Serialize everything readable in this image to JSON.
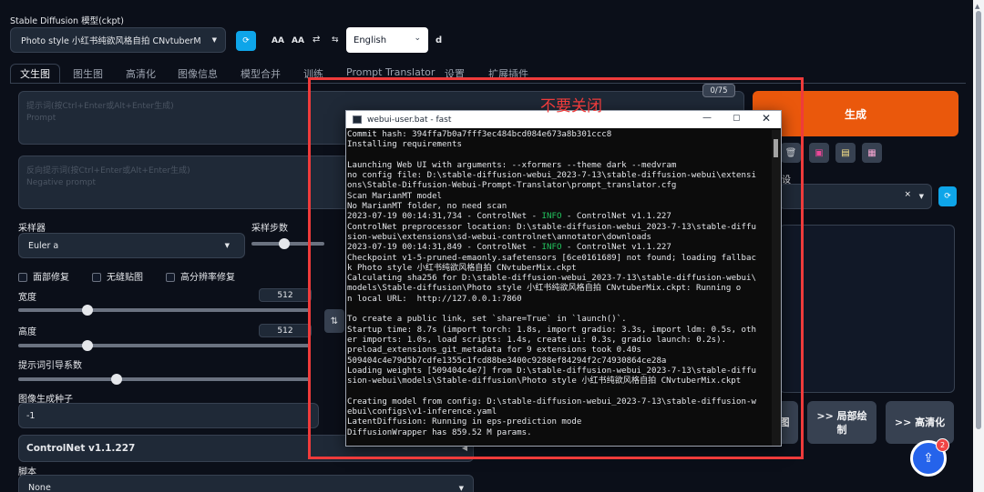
{
  "header": {
    "ckpt_label": "Stable Diffusion 模型(ckpt)",
    "ckpt_value": "Photo style 小红书纯欲风格自拍 CNvtuberMix.ckpt",
    "aa_large": "AA",
    "aa_small": "AA",
    "swap_symbol": "⇄",
    "lang_value": "English",
    "d_label": "d"
  },
  "tabs": [
    "文生图",
    "图生图",
    "高清化",
    "图像信息",
    "模型合并",
    "训练",
    "Prompt Translator",
    "设置",
    "扩展插件"
  ],
  "prompt": {
    "counter": "0/75",
    "placeholder_cn": "提示词(按Ctrl+Enter或Alt+Enter生成)",
    "placeholder_en": "Prompt",
    "neg_placeholder_cn": "反向提示词(按Ctrl+Enter或Alt+Enter生成)",
    "neg_placeholder_en": "Negative prompt"
  },
  "annotation": "不要关闭",
  "generate_label": "生成",
  "style_partial": "设",
  "sampler": {
    "label": "采样器",
    "value": "Euler a",
    "steps_label": "采样步数"
  },
  "checkboxes": [
    "面部修复",
    "无缝贴图",
    "高分辨率修复"
  ],
  "width": {
    "label": "宽度",
    "value": 512
  },
  "height": {
    "label": "高度",
    "value": 512
  },
  "swap_dims_symbol": "⇅",
  "cfg": {
    "label": "提示词引导系数"
  },
  "seed": {
    "label": "图像生成种子",
    "value": "-1"
  },
  "controlnet": {
    "label": "ControlNet v1.1.227",
    "arrow": "◀"
  },
  "script": {
    "label": "脚本",
    "value": "None"
  },
  "send_buttons": {
    "partial": "图",
    "inpaint": ">> 局部绘制",
    "extras": ">> 高清化"
  },
  "upload_badge": "2",
  "terminal": {
    "title": "webui-user.bat - fast",
    "lines": [
      [
        {
          "t": "Commit hash: 394ffa7b0a7fff3ec484bcd084e673a8b301ccc8"
        }
      ],
      [
        {
          "t": "Installing requirements"
        }
      ],
      [
        {
          "t": ""
        }
      ],
      [
        {
          "t": "Launching Web UI with arguments: --xformers --theme dark --medvram"
        }
      ],
      [
        {
          "t": "no config file: D:\\stable-diffusion-webui_2023-7-13\\stable-diffusion-webui\\extensi"
        }
      ],
      [
        {
          "t": "ons\\Stable-Diffusion-Webui-Prompt-Translator\\prompt_translator.cfg"
        }
      ],
      [
        {
          "t": "Scan MarianMT model"
        }
      ],
      [
        {
          "t": "No MarianMT folder, no need scan"
        }
      ],
      [
        {
          "t": "2023-07-19 00:14:31,734 - ControlNet - "
        },
        {
          "t": "INFO",
          "c": "info"
        },
        {
          "t": " - ControlNet v1.1.227"
        }
      ],
      [
        {
          "t": "ControlNet preprocessor location: D:\\stable-diffusion-webui_2023-7-13\\stable-diffu"
        }
      ],
      [
        {
          "t": "sion-webui\\extensions\\sd-webui-controlnet\\annotator\\downloads"
        }
      ],
      [
        {
          "t": "2023-07-19 00:14:31,849 - ControlNet - "
        },
        {
          "t": "INFO",
          "c": "info"
        },
        {
          "t": " - ControlNet v1.1.227"
        }
      ],
      [
        {
          "t": "Checkpoint v1-5-pruned-emaonly.safetensors [6ce0161689] not found; loading fallbac"
        }
      ],
      [
        {
          "t": "k Photo style 小红书纯欲风格自拍 CNvtuberMix.ckpt"
        }
      ],
      [
        {
          "t": "Calculating sha256 for D:\\stable-diffusion-webui_2023-7-13\\stable-diffusion-webui\\"
        }
      ],
      [
        {
          "t": "models\\Stable-diffusion\\Photo style 小红书纯欲风格自拍 CNvtuberMix.ckpt: Running o"
        }
      ],
      [
        {
          "t": "n local URL:  http://127.0.0.1:7860"
        }
      ],
      [
        {
          "t": ""
        }
      ],
      [
        {
          "t": "To create a public link, set `share=True` in `launch()`."
        }
      ],
      [
        {
          "t": "Startup time: 8.7s (import torch: 1.8s, import gradio: 3.3s, import ldm: 0.5s, oth"
        }
      ],
      [
        {
          "t": "er imports: 1.0s, load scripts: 1.4s, create ui: 0.3s, gradio launch: 0.2s)."
        }
      ],
      [
        {
          "t": "preload_extensions_git_metadata for 9 extensions took 0.40s"
        }
      ],
      [
        {
          "t": "509404c4e79d5b7cdfe1355c1fcd88be3400c9288ef84294f2c74930864ce28a"
        }
      ],
      [
        {
          "t": "Loading weights [509404c4e7] from D:\\stable-diffusion-webui_2023-7-13\\stable-diffu"
        }
      ],
      [
        {
          "t": "sion-webui\\models\\Stable-diffusion\\Photo style 小红书纯欲风格自拍 CNvtuberMix.ckpt"
        }
      ],
      [
        {
          "t": ""
        }
      ],
      [
        {
          "t": "Creating model from config: D:\\stable-diffusion-webui_2023-7-13\\stable-diffusion-w"
        }
      ],
      [
        {
          "t": "ebui\\configs\\v1-inference.yaml"
        }
      ],
      [
        {
          "t": "LatentDiffusion: Running in eps-prediction mode"
        }
      ],
      [
        {
          "t": "DiffusionWrapper has 859.52 M params."
        }
      ]
    ]
  }
}
